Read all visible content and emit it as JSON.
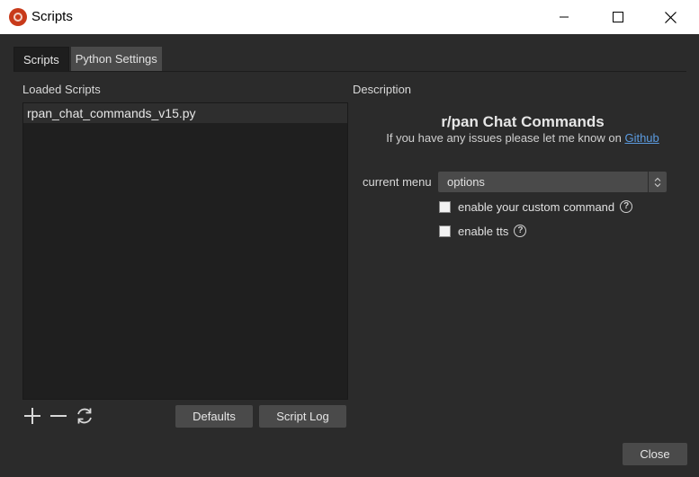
{
  "window": {
    "title": "Scripts"
  },
  "tabs": [
    {
      "label": "Scripts",
      "active": true
    },
    {
      "label": "Python Settings",
      "active": false
    }
  ],
  "left_panel": {
    "heading": "Loaded Scripts",
    "scripts": [
      "rpan_chat_commands_v15.py"
    ],
    "buttons": {
      "defaults": "Defaults",
      "script_log": "Script Log"
    },
    "icons": [
      "add-icon",
      "remove-icon",
      "reload-icon"
    ]
  },
  "right_panel": {
    "heading": "Description",
    "script_title": "r/pan Chat Commands",
    "subtitle_text": "If you have any issues please let me know on",
    "subtitle_link": "Github",
    "current_menu_label": "current menu",
    "current_menu_value": "options",
    "checkboxes": [
      {
        "label": "enable your custom command",
        "checked": false
      },
      {
        "label": "enable tts",
        "checked": false
      }
    ]
  },
  "footer": {
    "close_label": "Close"
  },
  "colors": {
    "background": "#2b2b2b",
    "link": "#5b9be0",
    "app_icon": "#c83a1a"
  }
}
